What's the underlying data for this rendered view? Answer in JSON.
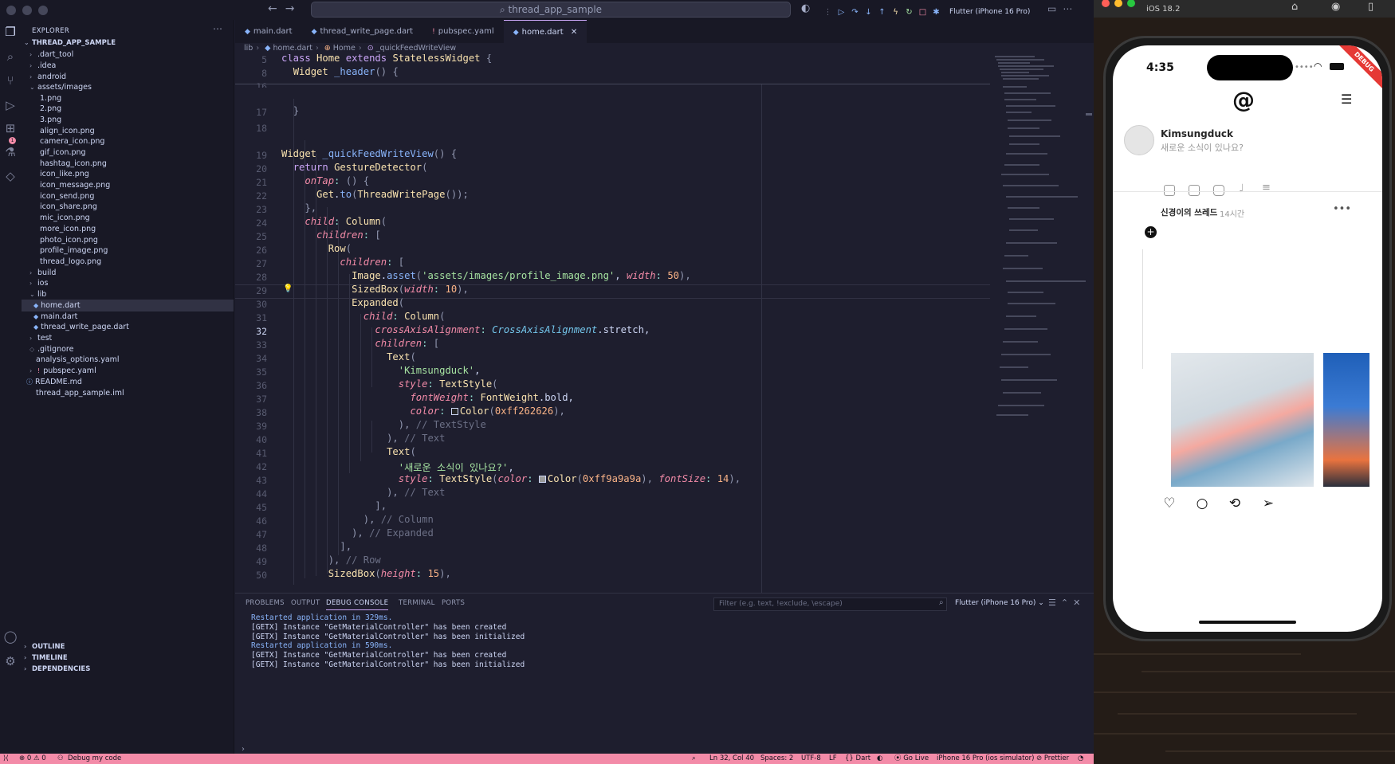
{
  "window": {
    "search_text": "thread_app_sample",
    "device_selector": "Flutter (iPhone 16 Pro)"
  },
  "explorer": {
    "header": "EXPLORER",
    "project": "THREAD_APP_SAMPLE",
    "items": [
      {
        "label": ".dart_tool"
      },
      {
        "label": ".idea"
      },
      {
        "label": "android"
      },
      {
        "label": "assets/images"
      },
      {
        "label": "1.png"
      },
      {
        "label": "2.png"
      },
      {
        "label": "3.png"
      },
      {
        "label": "align_icon.png"
      },
      {
        "label": "camera_icon.png"
      },
      {
        "label": "gif_icon.png"
      },
      {
        "label": "hashtag_icon.png"
      },
      {
        "label": "icon_like.png"
      },
      {
        "label": "icon_message.png"
      },
      {
        "label": "icon_send.png"
      },
      {
        "label": "icon_share.png"
      },
      {
        "label": "mic_icon.png"
      },
      {
        "label": "more_icon.png"
      },
      {
        "label": "photo_icon.png"
      },
      {
        "label": "profile_image.png"
      },
      {
        "label": "thread_logo.png"
      },
      {
        "label": "build"
      },
      {
        "label": "ios"
      },
      {
        "label": "lib"
      },
      {
        "label": "home.dart"
      },
      {
        "label": "main.dart"
      },
      {
        "label": "thread_write_page.dart"
      },
      {
        "label": "test"
      },
      {
        "label": ".gitignore"
      },
      {
        "label": "analysis_options.yaml"
      },
      {
        "label": "pubspec.yaml"
      },
      {
        "label": "README.md"
      },
      {
        "label": "thread_app_sample.iml"
      }
    ],
    "sections": [
      "OUTLINE",
      "TIMELINE",
      "DEPENDENCIES"
    ]
  },
  "tabs": [
    {
      "label": "main.dart"
    },
    {
      "label": "thread_write_page.dart"
    },
    {
      "label": "pubspec.yaml"
    },
    {
      "label": "home.dart"
    }
  ],
  "breadcrumb": [
    "lib",
    "home.dart",
    "Home",
    "_quickFeedWriteView"
  ],
  "editor": {
    "line_numbers": [
      "5",
      "8",
      "16",
      "17",
      "18",
      "19",
      "20",
      "21",
      "22",
      "23",
      "24",
      "25",
      "26",
      "27",
      "28",
      "29",
      "30",
      "31",
      "32",
      "33",
      "34",
      "35",
      "36",
      "37",
      "38",
      "39",
      "40",
      "41",
      "42",
      "43",
      "44",
      "45",
      "46",
      "47",
      "48",
      "49",
      "50"
    ],
    "current_line": "32"
  },
  "panel": {
    "tabs": [
      "PROBLEMS",
      "OUTPUT",
      "DEBUG CONSOLE",
      "TERMINAL",
      "PORTS"
    ],
    "filter_placeholder": "Filter (e.g. text, !exclude, \\escape)",
    "device": "Flutter (iPhone 16 Pro)",
    "logs": [
      "Restarted application in 329ms.",
      "[GETX] Instance \"GetMaterialController\" has been created",
      "[GETX] Instance \"GetMaterialController\" has been initialized",
      "Restarted application in 590ms.",
      "[GETX] Instance \"GetMaterialController\" has been created",
      "[GETX] Instance \"GetMaterialController\" has been initialized"
    ]
  },
  "status": {
    "errors": "0",
    "warnings": "0",
    "debug": "Debug my code",
    "position": "Ln 32, Col 40",
    "spaces": "Spaces: 2",
    "encoding": "UTF-8",
    "eol": "LF",
    "language": "Dart",
    "golive": "Go Live",
    "device": "iPhone 16 Pro (ios simulator)",
    "prettier": "Prettier"
  },
  "simulator": {
    "ios_version": "iOS 18.2",
    "time": "4:35",
    "debug_banner": "DEBUG",
    "composer_name": "Kimsungduck",
    "composer_hint": "새로운 소식이 있나요?",
    "thread_title": "신경이의 쓰레드",
    "thread_time": "14시간"
  },
  "colors": {
    "accent": "#cba6f7",
    "status_bar": "#f38ba8",
    "editor_bg": "#1e1e2e"
  }
}
